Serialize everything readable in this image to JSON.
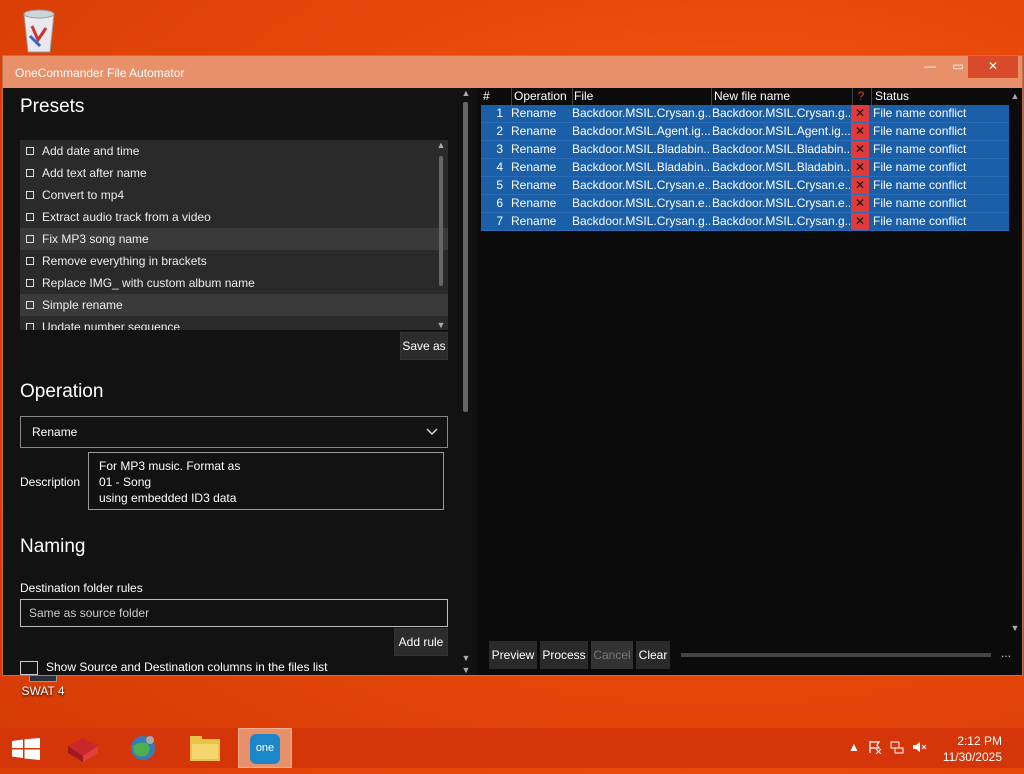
{
  "desktop": {
    "recycle_bin_icon": "recycle-bin-icon",
    "swat_label": "SWAT 4"
  },
  "window": {
    "title": "OneCommander File Automator",
    "controls": {
      "minimize": "—",
      "maximize": "▭",
      "close": "✕"
    }
  },
  "presets": {
    "heading": "Presets",
    "items": [
      {
        "label": "Add date and time",
        "selected": false
      },
      {
        "label": "Add text after name",
        "selected": false
      },
      {
        "label": "Convert to mp4",
        "selected": false
      },
      {
        "label": "Extract audio track from a video",
        "selected": false
      },
      {
        "label": "Fix MP3 song name",
        "selected": true
      },
      {
        "label": "Remove everything in brackets",
        "selected": false
      },
      {
        "label": "Replace IMG_ with custom album name",
        "selected": false
      },
      {
        "label": "Simple rename",
        "selected": true
      },
      {
        "label": "Update number sequence",
        "selected": false
      }
    ],
    "save_as_label": "Save as"
  },
  "operation": {
    "heading": "Operation",
    "selected": "Rename",
    "description_label": "Description",
    "description_lines": [
      "For MP3 music. Format as",
      "01 - Song",
      "using embedded ID3 data"
    ]
  },
  "naming": {
    "heading": "Naming",
    "destination_label": "Destination folder rules",
    "destination_value": "Same as source folder",
    "add_rule_label": "Add rule",
    "show_columns_label": "Show Source and Destination columns in the files list"
  },
  "grid": {
    "columns": [
      "#",
      "Operation",
      "File",
      "New file name",
      "?",
      "Status"
    ],
    "rows": [
      {
        "num": "1",
        "op": "Rename",
        "file": "Backdoor.MSIL.Crysan.g...",
        "new": "Backdoor.MSIL.Crysan.g...",
        "status": "File name conflict"
      },
      {
        "num": "2",
        "op": "Rename",
        "file": "Backdoor.MSIL.Agent.ig...",
        "new": "Backdoor.MSIL.Agent.ig...",
        "status": "File name conflict"
      },
      {
        "num": "3",
        "op": "Rename",
        "file": "Backdoor.MSIL.Bladabin...",
        "new": "Backdoor.MSIL.Bladabin...",
        "status": "File name conflict"
      },
      {
        "num": "4",
        "op": "Rename",
        "file": "Backdoor.MSIL.Bladabin...",
        "new": "Backdoor.MSIL.Bladabin...",
        "status": "File name conflict"
      },
      {
        "num": "5",
        "op": "Rename",
        "file": "Backdoor.MSIL.Crysan.e...",
        "new": "Backdoor.MSIL.Crysan.e...",
        "status": "File name conflict"
      },
      {
        "num": "6",
        "op": "Rename",
        "file": "Backdoor.MSIL.Crysan.e...",
        "new": "Backdoor.MSIL.Crysan.e...",
        "status": "File name conflict"
      },
      {
        "num": "7",
        "op": "Rename",
        "file": "Backdoor.MSIL.Crysan.g...",
        "new": "Backdoor.MSIL.Crysan.g...",
        "status": "File name conflict"
      }
    ],
    "conflict_mark": "✕"
  },
  "actions": {
    "preview": "Preview",
    "process": "Process",
    "cancel": "Cancel",
    "clear": "Clear",
    "more": "..."
  },
  "taskbar": {
    "time": "2:12 PM",
    "date": "11/30/2025",
    "one_label": "one"
  },
  "colors": {
    "accent_blue": "#1a5fa8",
    "conflict_red": "#e03a3a",
    "title_orange": "#e8906a"
  }
}
